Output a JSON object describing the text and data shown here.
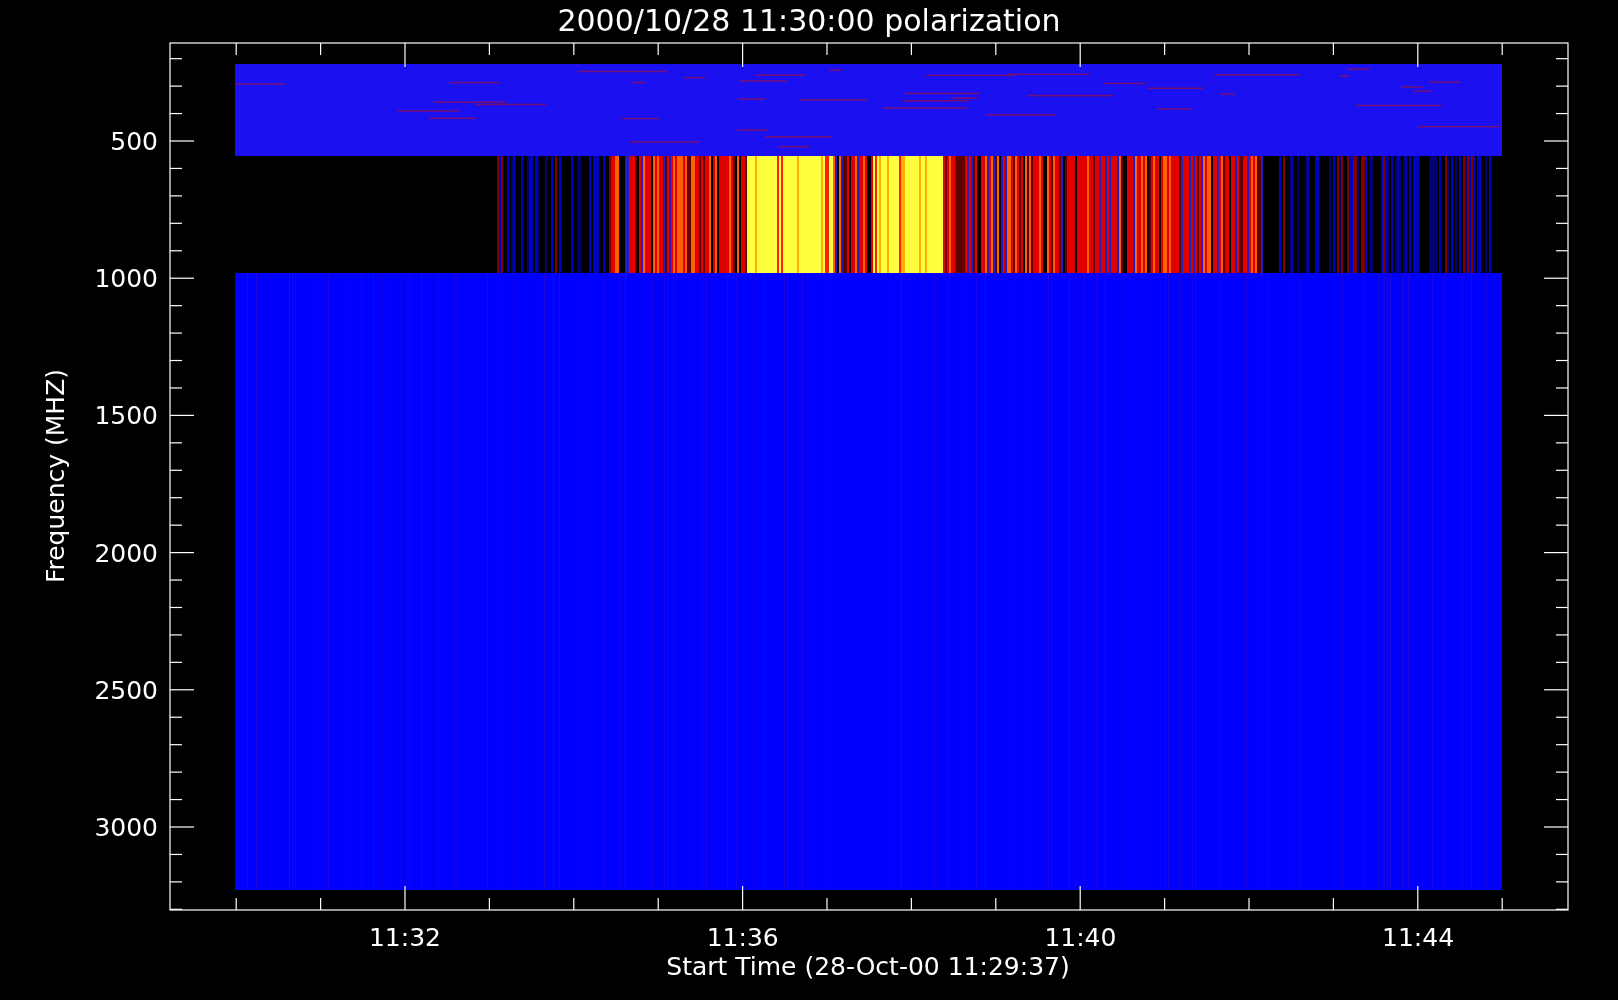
{
  "title": "2000/10/28 11:30:00 polarization",
  "y_axis": {
    "label": "Frequency (MHZ)",
    "ticks": [
      "500",
      "1000",
      "1500",
      "2000",
      "2500",
      "3000"
    ]
  },
  "x_axis": {
    "label": "Start Time (28-Oct-00 11:29:37)",
    "ticks": [
      "11:32",
      "11:36",
      "11:40",
      "11:44"
    ]
  }
}
